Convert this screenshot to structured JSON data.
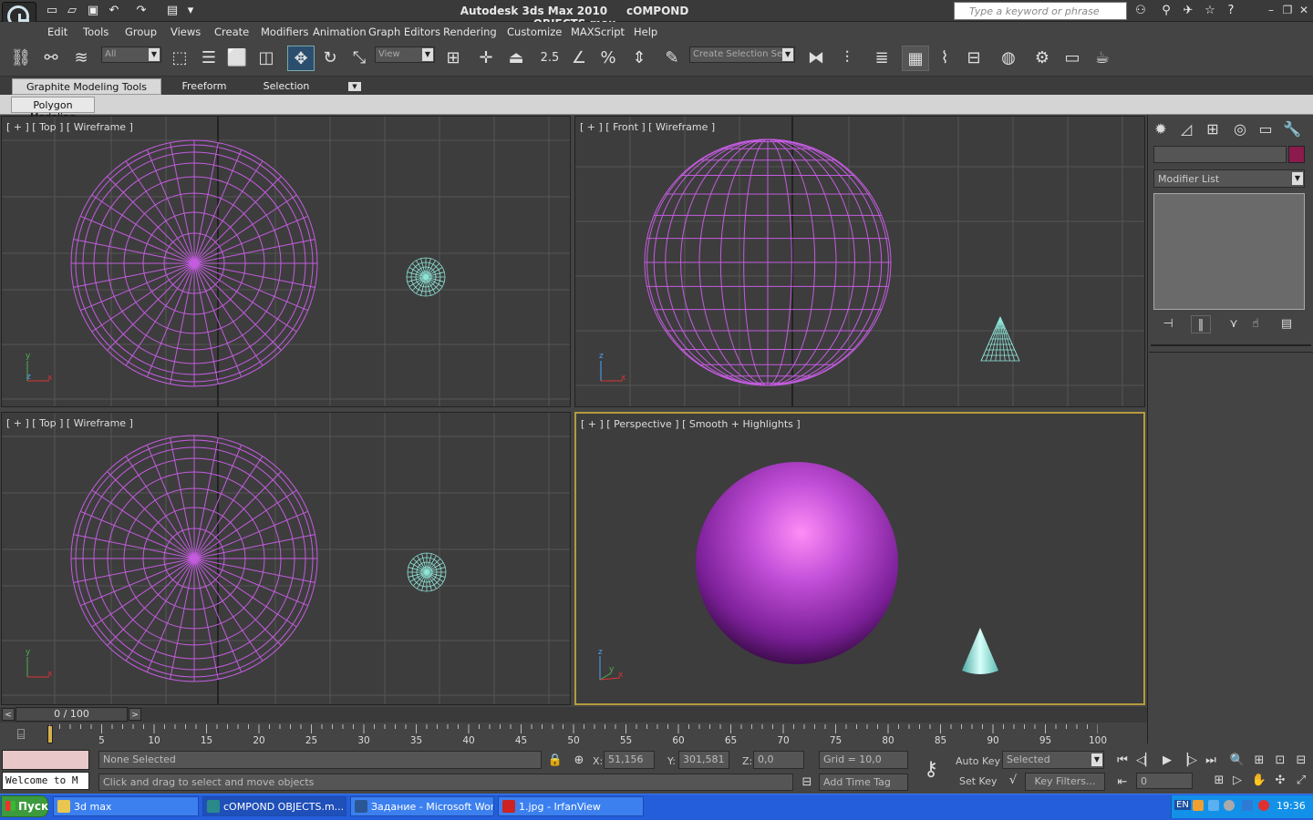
{
  "title_bar": {
    "app_name": "Autodesk 3ds Max  2010",
    "file_name": "cOMPOND OBJECTS.max",
    "search_placeholder": "Type a keyword or phrase"
  },
  "menu": [
    "Edit",
    "Tools",
    "Group",
    "Views",
    "Create",
    "Modifiers",
    "Animation",
    "Graph Editors",
    "Rendering",
    "Customize",
    "MAXScript",
    "Help"
  ],
  "toolbar": {
    "selection_filter": "All",
    "reference_coord": "View",
    "snap_label": "2.5",
    "named_selection": "Create Selection Se"
  },
  "ribbon": {
    "tabs": [
      "Graphite Modeling Tools",
      "Freeform",
      "Selection"
    ],
    "panel_tab": "Polygon Modeling"
  },
  "viewports": {
    "top_left": "[ + ] [ Top ] [ Wireframe ]",
    "top_right": "[ + ] [ Front ] [ Wireframe ]",
    "bottom_left": "[ + ] [ Top ] [ Wireframe ]",
    "bottom_right": "[ + ] [ Perspective ] [ Smooth + Highlights ]",
    "axis_y": "y",
    "axis_z": "z",
    "axis_x": "x"
  },
  "command_panel": {
    "modifier_list": "Modifier List",
    "icons": [
      "create-icon",
      "modify-icon",
      "hierarchy-icon",
      "motion-icon",
      "display-icon",
      "utilities-icon"
    ]
  },
  "timeline": {
    "slider_label": "0 / 100",
    "left_arrow": "<",
    "right_arrow": ">",
    "ticks": [
      "5",
      "10",
      "15",
      "20",
      "25",
      "30",
      "35",
      "40",
      "45",
      "50",
      "55",
      "60",
      "65",
      "70",
      "75",
      "80",
      "85",
      "90",
      "95",
      "100"
    ]
  },
  "status": {
    "selection": "None Selected",
    "prompt": "Click and drag to select and move objects",
    "welcome": "Welcome to M",
    "x_label": "X:",
    "x_value": "51,156",
    "y_label": "Y:",
    "y_value": "301,581",
    "z_label": "Z:",
    "z_value": "0,0",
    "grid": "Grid = 10,0",
    "add_time_tag": "Add Time Tag",
    "auto_key": "Auto Key",
    "set_key": "Set Key",
    "selected_dropdown": "Selected",
    "key_filters": "Key Filters...",
    "frame_value": "0"
  },
  "taskbar": {
    "start": "Пуск",
    "items": [
      {
        "label": "3d max",
        "icon_color": "#e8c650"
      },
      {
        "label": "cOMPOND OBJECTS.m...",
        "icon_color": "#2a8a8a"
      },
      {
        "label": "Задание - Microsoft Word",
        "icon_color": "#2b5797"
      },
      {
        "label": "1.jpg - IrfanView",
        "icon_color": "#cc2222"
      }
    ],
    "lang": "EN",
    "clock": "19:36"
  },
  "colors": {
    "wire_sphere": "#c45ce0",
    "wire_cone": "#8fe6d9",
    "active_border": "#b49b3c",
    "viewport_bg": "#3d3d3d"
  }
}
